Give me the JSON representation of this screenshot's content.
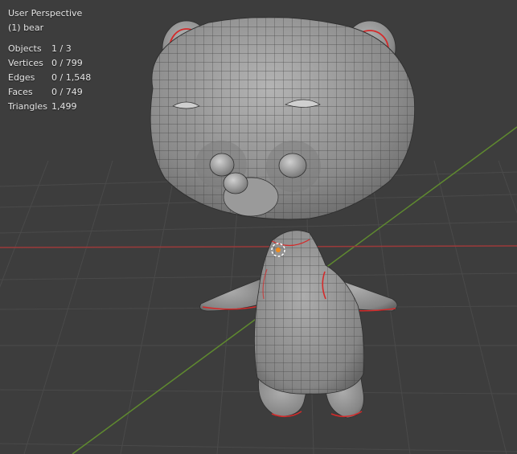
{
  "viewport": {
    "view_name": "User Perspective",
    "object_name": "(1) bear"
  },
  "stats": [
    {
      "label": "Objects",
      "value": "1 / 3"
    },
    {
      "label": "Vertices",
      "value": "0 / 799"
    },
    {
      "label": "Edges",
      "value": "0 / 1,548"
    },
    {
      "label": "Faces",
      "value": "0 / 749"
    },
    {
      "label": "Triangles",
      "value": "1,499"
    }
  ],
  "colors": {
    "background": "#3d3d3d",
    "grid": "#4a4a4a",
    "x_axis": "#9c3a3a",
    "y_axis": "#5f8a2f",
    "mesh_fill": "#8f8f8f",
    "wire": "#2f2f2f",
    "seam": "#d42a2a",
    "origin": "#f08a1c"
  },
  "icons": {
    "origin": "object-origin-icon"
  }
}
